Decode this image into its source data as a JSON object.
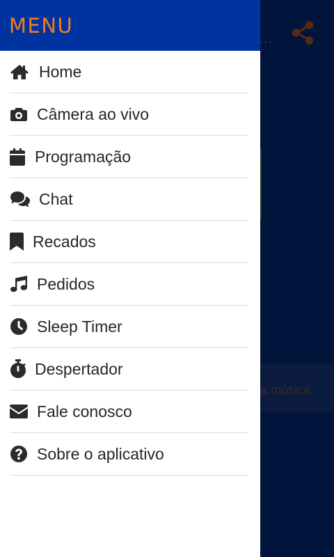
{
  "drawer": {
    "title": "MENU",
    "items": [
      {
        "label": "Home",
        "icon": "home-icon"
      },
      {
        "label": "Câmera ao vivo",
        "icon": "camera-icon"
      },
      {
        "label": "Programação",
        "icon": "calendar-icon"
      },
      {
        "label": "Chat",
        "icon": "comments-icon"
      },
      {
        "label": "Recados",
        "icon": "bookmark-icon"
      },
      {
        "label": "Pedidos",
        "icon": "music-icon"
      },
      {
        "label": "Sleep Timer",
        "icon": "clock-icon"
      },
      {
        "label": "Despertador",
        "icon": "stopwatch-icon"
      },
      {
        "label": "Fale conosco",
        "icon": "envelope-icon"
      },
      {
        "label": "Sobre o aplicativo",
        "icon": "question-circle-icon"
      }
    ]
  },
  "background": {
    "header_ellipsis": "...",
    "banner_text": "a música"
  },
  "colors": {
    "header_bg": "#0033a0",
    "header_title": "#f47b20",
    "overlay_bg": "#00143c",
    "icon": "#2b2b2b",
    "divider": "#dcdcdc"
  }
}
